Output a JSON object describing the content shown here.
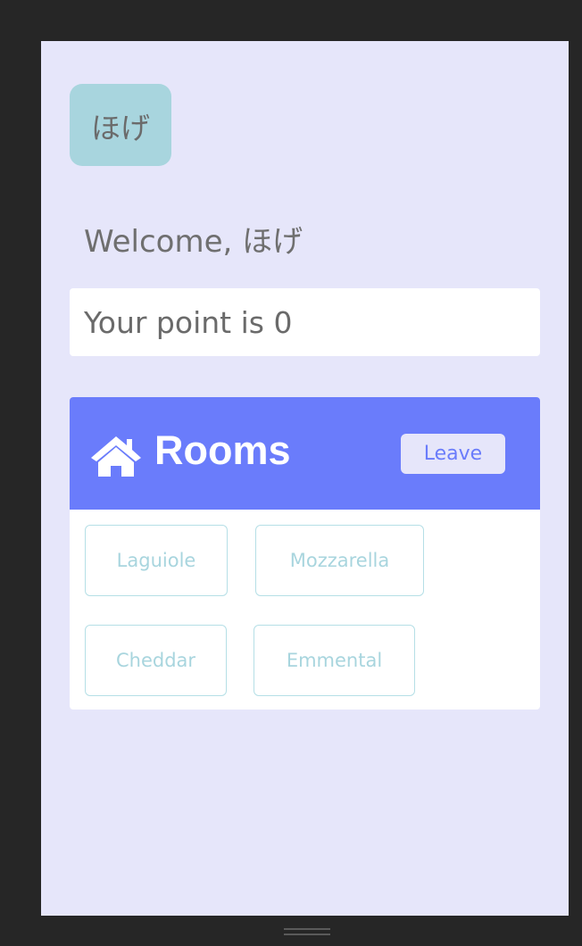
{
  "user": {
    "avatar_label": "ほげ",
    "welcome_text": "Welcome, ほげ",
    "points_text": "Your point is 0"
  },
  "rooms": {
    "title": "Rooms",
    "icon": "home-icon",
    "leave_label": "Leave",
    "items": [
      {
        "label": "Laguiole"
      },
      {
        "label": "Mozzarella"
      },
      {
        "label": "Cheddar"
      },
      {
        "label": "Emmental"
      }
    ]
  },
  "colors": {
    "screen_bg": "#e6e6fa",
    "header_bg": "#6a7cfb",
    "avatar_bg": "#a8d5de",
    "room_border": "#b5dfe6"
  }
}
